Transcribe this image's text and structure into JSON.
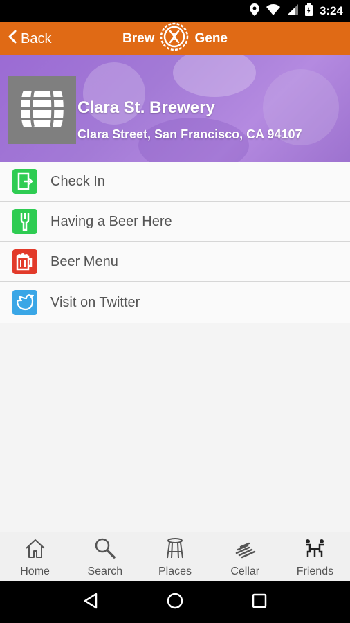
{
  "status_bar": {
    "time": "3:24"
  },
  "app_bar": {
    "back_label": "Back",
    "brand_left": "Brew",
    "brand_right": "Gene",
    "color": "#e06a15"
  },
  "venue": {
    "name": "Clara St. Brewery",
    "address": "Clara Street, San Francisco, CA 94107"
  },
  "actions": [
    {
      "label": "Check In",
      "icon": "door-exit-icon",
      "color": "#2ecc52"
    },
    {
      "label": "Having a Beer Here",
      "icon": "tap-handle-icon",
      "color": "#2ecc52"
    },
    {
      "label": "Beer Menu",
      "icon": "beer-mug-icon",
      "color": "#e23a2a"
    },
    {
      "label": "Visit on Twitter",
      "icon": "twitter-bird-icon",
      "color": "#3aa6e6"
    }
  ],
  "tabs": [
    {
      "label": "Home",
      "icon": "home-icon"
    },
    {
      "label": "Search",
      "icon": "search-icon"
    },
    {
      "label": "Places",
      "icon": "bar-stool-icon"
    },
    {
      "label": "Cellar",
      "icon": "cellar-icon"
    },
    {
      "label": "Friends",
      "icon": "friends-icon"
    }
  ]
}
